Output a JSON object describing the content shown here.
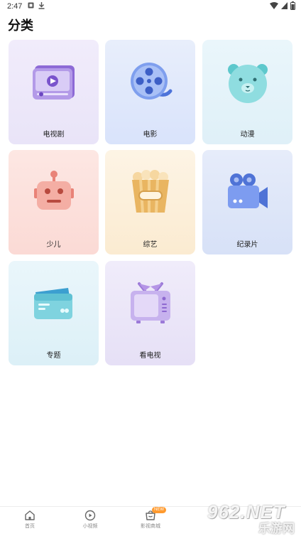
{
  "status_bar": {
    "time": "2:47"
  },
  "page": {
    "title": "分类"
  },
  "categories": [
    {
      "label": "电视剧",
      "icon": "tv-series-icon"
    },
    {
      "label": "电影",
      "icon": "film-reel-icon"
    },
    {
      "label": "动漫",
      "icon": "bear-face-icon"
    },
    {
      "label": "少儿",
      "icon": "robot-icon"
    },
    {
      "label": "综艺",
      "icon": "popcorn-icon"
    },
    {
      "label": "纪录片",
      "icon": "video-camera-icon"
    },
    {
      "label": "专题",
      "icon": "folder-cards-icon"
    },
    {
      "label": "看电视",
      "icon": "retro-tv-icon"
    }
  ],
  "bottom_nav": {
    "items": [
      {
        "label": "首页",
        "icon": "home-icon"
      },
      {
        "label": "小视频",
        "icon": "play-circle-icon"
      },
      {
        "label": "影视商城",
        "icon": "shop-icon",
        "badge": "NEW"
      }
    ]
  },
  "watermark": {
    "main": "962.NET",
    "sub": "乐游网"
  }
}
